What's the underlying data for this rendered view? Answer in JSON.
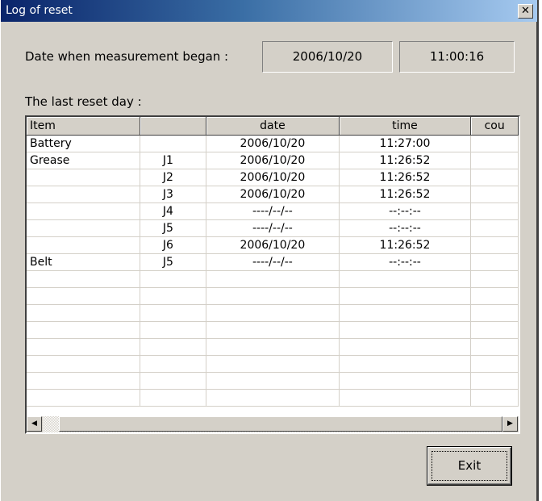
{
  "window": {
    "title": "Log of reset"
  },
  "measurement": {
    "label": "Date when measurement began :",
    "date": "2006/10/20",
    "time": "11:00:16"
  },
  "section_label": "The last reset day :",
  "table": {
    "columns": [
      "Item",
      "",
      "date",
      "time",
      "cou"
    ],
    "rows": [
      [
        "Battery",
        "",
        "2006/10/20",
        "11:27:00",
        ""
      ],
      [
        "Grease",
        "J1",
        "2006/10/20",
        "11:26:52",
        ""
      ],
      [
        "",
        "J2",
        "2006/10/20",
        "11:26:52",
        ""
      ],
      [
        "",
        "J3",
        "2006/10/20",
        "11:26:52",
        ""
      ],
      [
        "",
        "J4",
        "----/--/--",
        "--:--:--",
        ""
      ],
      [
        "",
        "J5",
        "----/--/--",
        "--:--:--",
        ""
      ],
      [
        "",
        "J6",
        "2006/10/20",
        "11:26:52",
        ""
      ],
      [
        "Belt",
        "J5",
        "----/--/--",
        "--:--:--",
        ""
      ],
      [
        "",
        "",
        "",
        "",
        ""
      ],
      [
        "",
        "",
        "",
        "",
        ""
      ],
      [
        "",
        "",
        "",
        "",
        ""
      ],
      [
        "",
        "",
        "",
        "",
        ""
      ],
      [
        "",
        "",
        "",
        "",
        ""
      ],
      [
        "",
        "",
        "",
        "",
        ""
      ],
      [
        "",
        "",
        "",
        "",
        ""
      ],
      [
        "",
        "",
        "",
        "",
        ""
      ]
    ]
  },
  "buttons": {
    "exit": "Exit",
    "close_glyph": "✕"
  },
  "scroll": {
    "left_glyph": "◀",
    "right_glyph": "▶"
  }
}
